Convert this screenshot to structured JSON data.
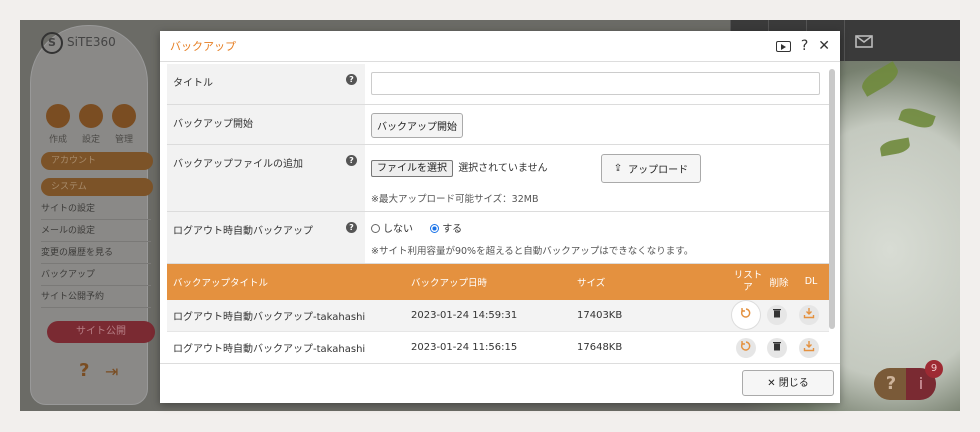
{
  "app": {
    "logo_text": "SiTE360"
  },
  "topbar": {
    "icons": [
      "grid-icon",
      "user-circle-icon",
      "building-icon",
      "mail-icon"
    ]
  },
  "sidebar": {
    "icons": [
      {
        "label": "作成",
        "icon": "pencil-icon"
      },
      {
        "label": "設定",
        "icon": "gear-icon"
      },
      {
        "label": "管理",
        "icon": "person-icon"
      }
    ],
    "account_label": "アカウント",
    "system_label": "システム",
    "items": [
      "サイトの設定",
      "メールの設定",
      "変更の履歴を見る",
      "バックアップ",
      "サイト公開予約"
    ],
    "publish_label": "サイト公開"
  },
  "floating": {
    "help_label": "?",
    "info_label": "i",
    "badge_count": "9"
  },
  "modal": {
    "title": "バックアップ",
    "form": {
      "title_label": "タイトル",
      "title_value": "",
      "start_label": "バックアップ開始",
      "start_button": "バックアップ開始",
      "add_label": "バックアップファイルの追加",
      "file_button": "ファイルを選択",
      "file_status": "選択されていません",
      "upload_button": "アップロード",
      "max_size_note": "※最大アップロード可能サイズ：32MB",
      "auto_label": "ログアウト時自動バックアップ",
      "option_off": "しない",
      "option_on": "する",
      "auto_note": "※サイト利用容量が90%を超えると自動バックアップはできなくなります。"
    },
    "list": {
      "headers": {
        "title": "バックアップタイトル",
        "date": "バックアップ日時",
        "size": "サイズ",
        "restore": "リストア",
        "delete": "削除",
        "download": "DL"
      },
      "rows": [
        {
          "title": "ログアウト時自動バックアップ-takahashi",
          "date": "2023-01-24 14:59:31",
          "size": "17403KB"
        },
        {
          "title": "ログアウト時自動バックアップ-takahashi",
          "date": "2023-01-24 11:56:15",
          "size": "17648KB"
        }
      ]
    },
    "close_button": "✕ 閉じる",
    "tools": {
      "help": "?",
      "close": "✕"
    }
  }
}
